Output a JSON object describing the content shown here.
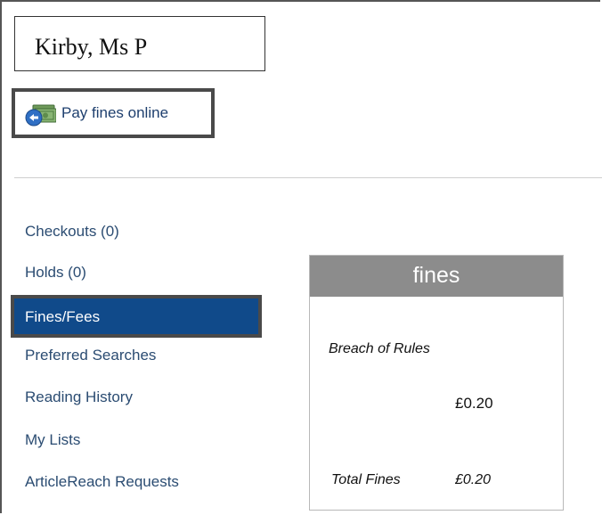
{
  "patron": {
    "name": "Kirby, Ms P"
  },
  "pay_online": {
    "label": "Pay fines online",
    "icon": "money-payment-icon"
  },
  "nav": {
    "items": [
      {
        "label": "Checkouts (0)"
      },
      {
        "label": "Holds (0)"
      },
      {
        "label": "Fines/Fees",
        "active": true
      },
      {
        "label": "Preferred Searches"
      },
      {
        "label": "Reading History"
      },
      {
        "label": "My Lists"
      },
      {
        "label": "ArticleReach Requests"
      }
    ]
  },
  "fines": {
    "title": "fines",
    "entries": [
      {
        "description": "Breach of Rules",
        "amount": "£0.20"
      }
    ],
    "total_label": "Total Fines",
    "total_amount": "£0.20"
  },
  "colors": {
    "active_nav_bg": "#104a8a",
    "panel_header_bg": "#8c8c8c",
    "link_text": "#2b4c72"
  }
}
